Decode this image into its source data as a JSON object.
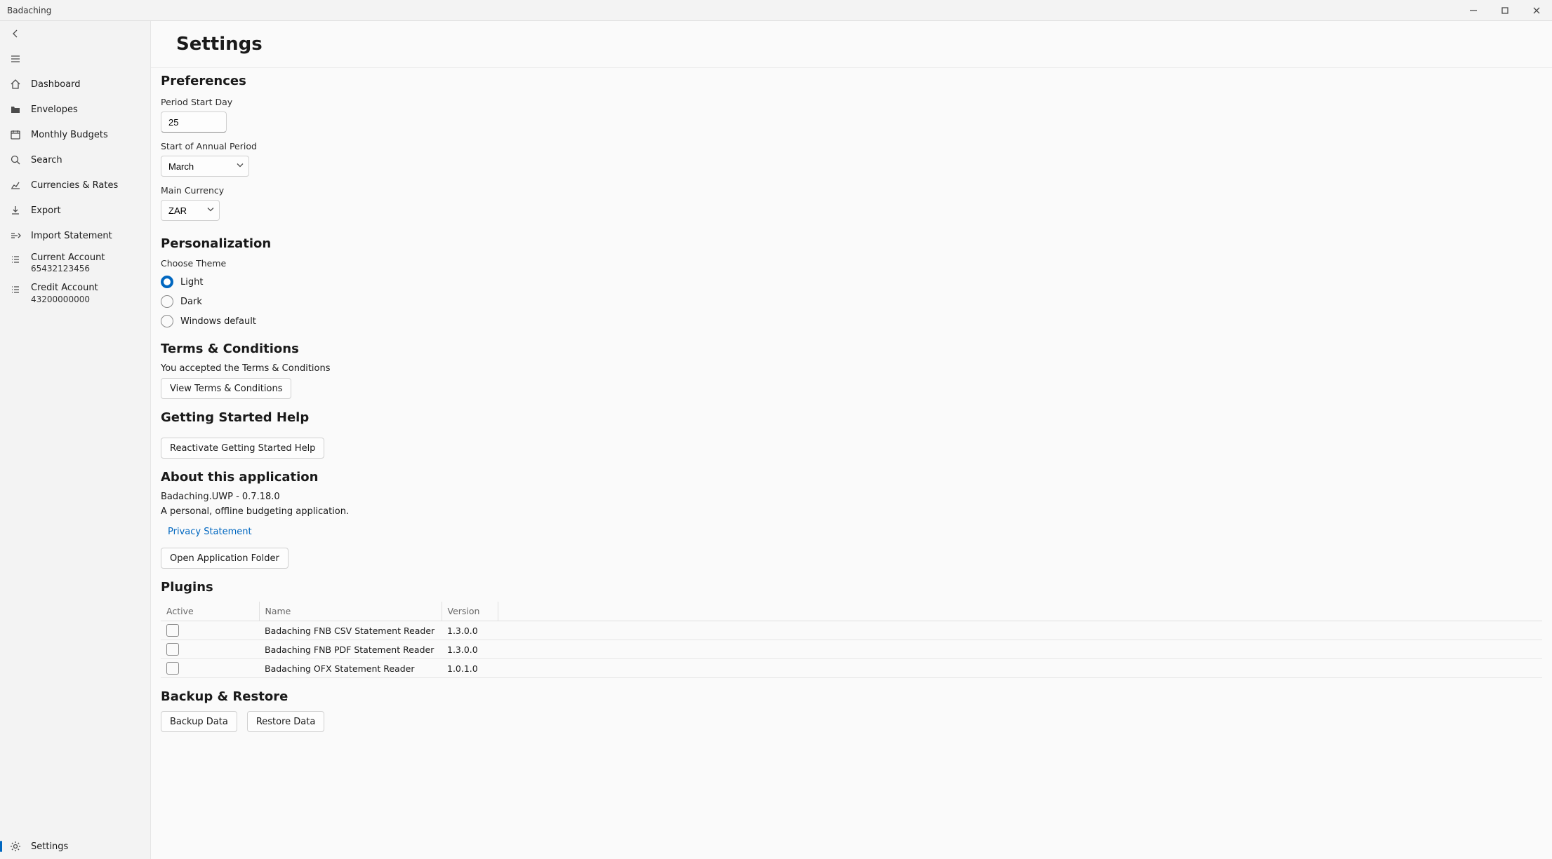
{
  "window": {
    "title": "Badaching"
  },
  "sidebar": {
    "items": [
      {
        "label": "Dashboard"
      },
      {
        "label": "Envelopes"
      },
      {
        "label": "Monthly Budgets"
      },
      {
        "label": "Search"
      },
      {
        "label": "Currencies & Rates"
      },
      {
        "label": "Export"
      },
      {
        "label": "Import Statement"
      }
    ],
    "accounts": [
      {
        "name": "Current Account",
        "number": "65432123456"
      },
      {
        "name": "Credit Account",
        "number": "43200000000"
      }
    ],
    "settings_label": "Settings"
  },
  "page": {
    "title": "Settings",
    "preferences": {
      "heading": "Preferences",
      "period_start_label": "Period Start Day",
      "period_start_value": "25",
      "annual_period_label": "Start of Annual Period",
      "annual_period_value": "March",
      "main_currency_label": "Main Currency",
      "main_currency_value": "ZAR"
    },
    "personalization": {
      "heading": "Personalization",
      "choose_theme_label": "Choose Theme",
      "options": [
        {
          "label": "Light",
          "checked": true
        },
        {
          "label": "Dark",
          "checked": false
        },
        {
          "label": "Windows default",
          "checked": false
        }
      ]
    },
    "terms": {
      "heading": "Terms & Conditions",
      "status": "You accepted the Terms & Conditions",
      "view_btn": "View Terms & Conditions"
    },
    "getting_started": {
      "heading": "Getting Started Help",
      "reactivate_btn": "Reactivate Getting Started Help"
    },
    "about": {
      "heading": "About this application",
      "version": "Badaching.UWP - 0.7.18.0",
      "description": "A personal, offline budgeting application.",
      "privacy_link": "Privacy Statement",
      "open_folder_btn": "Open Application Folder"
    },
    "plugins": {
      "heading": "Plugins",
      "columns": {
        "active": "Active",
        "name": "Name",
        "version": "Version"
      },
      "rows": [
        {
          "active": false,
          "name": "Badaching FNB CSV Statement Reader",
          "version": "1.3.0.0"
        },
        {
          "active": false,
          "name": "Badaching FNB PDF Statement Reader",
          "version": "1.3.0.0"
        },
        {
          "active": false,
          "name": "Badaching OFX Statement Reader",
          "version": "1.0.1.0"
        }
      ]
    },
    "backup": {
      "heading": "Backup & Restore",
      "backup_btn": "Backup Data",
      "restore_btn": "Restore Data"
    }
  }
}
